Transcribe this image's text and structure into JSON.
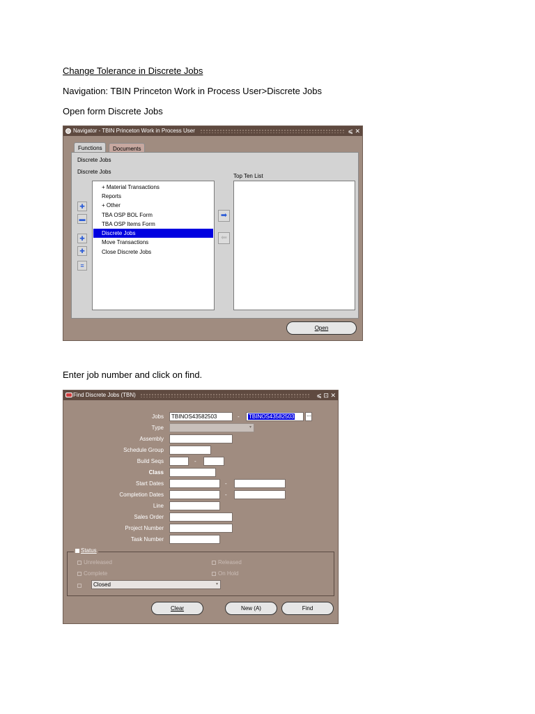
{
  "doc": {
    "heading": "Change Tolerance in Discrete Jobs",
    "navigation": "Navigation: TBIN Princeton Work in Process User>Discrete Jobs",
    "open_form": "Open form Discrete Jobs",
    "enter_job": "Enter job number and click on find."
  },
  "navigator": {
    "title": "Navigator - TBIN Princeton Work in Process User",
    "window_controls": "⩽ ✕",
    "tabs": [
      "Functions",
      "Documents"
    ],
    "line1": "Discrete Jobs",
    "line2": "Discrete Jobs",
    "items": [
      {
        "label": "+  Material Transactions",
        "selected": false
      },
      {
        "label": "Reports",
        "selected": false
      },
      {
        "label": "+  Other",
        "selected": false
      },
      {
        "label": "TBA OSP BOL Form",
        "selected": false
      },
      {
        "label": "TBA OSP Items Form",
        "selected": false
      },
      {
        "label": "Discrete Jobs",
        "selected": true
      },
      {
        "label": "Move Transactions",
        "selected": false
      },
      {
        "label": "Close Discrete Jobs",
        "selected": false
      }
    ],
    "top_ten_label": "Top Ten List",
    "open_button": "Open",
    "side_icons": [
      "expand-icon",
      "collapse-icon",
      "expand-branch-icon",
      "expand-all-icon",
      "collapse-all-icon"
    ],
    "add_arrow_icon": "right-arrow-icon",
    "remove_arrow_icon": "left-arrow-icon"
  },
  "find": {
    "title": "Find Discrete Jobs (TBN)",
    "window_controls": "⩽ ⊡ ✕",
    "labels": {
      "jobs": "Jobs",
      "type": "Type",
      "assembly": "Assembly",
      "schedule_group": "Schedule Group",
      "build_seqs": "Build Seqs",
      "class": "Class",
      "start_dates": "Start Dates",
      "completion_dates": "Completion Dates",
      "line": "Line",
      "sales_order": "Sales Order",
      "project_number": "Project Number",
      "task_number": "Task Number"
    },
    "jobs_from": "TBINOS43582503",
    "jobs_to": "TBINOS43582503",
    "status_label": "Status",
    "status_options": [
      "Unreleased",
      "Released",
      "Complete",
      "On Hold"
    ],
    "closed_value": "Closed",
    "buttons": {
      "clear": "Clear",
      "new": "New (A)",
      "find": "Find"
    },
    "dash": "-",
    "lov_icon": "ellipsis-icon"
  }
}
